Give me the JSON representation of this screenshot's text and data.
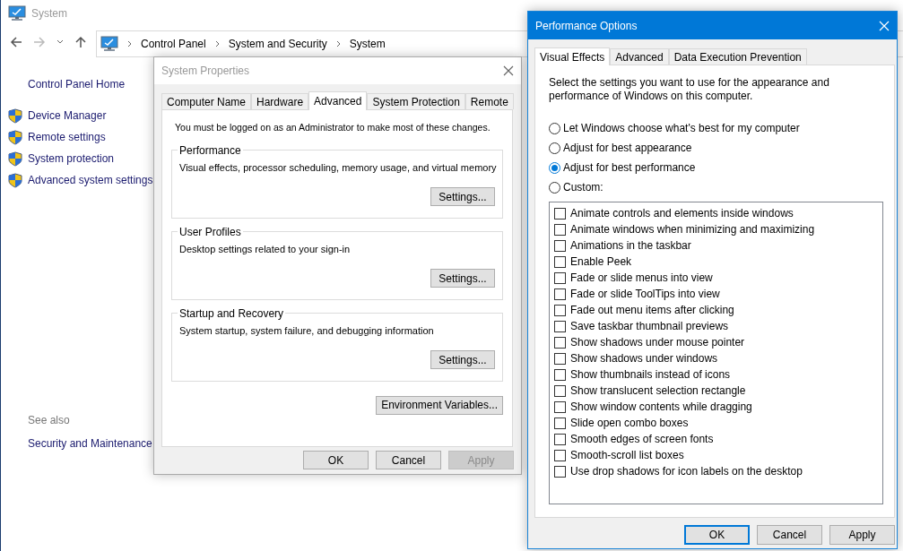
{
  "background_window": {
    "title": "System",
    "breadcrumb": [
      "Control Panel",
      "System and Security",
      "System"
    ],
    "sidebar": {
      "home": "Control Panel Home",
      "items": [
        "Device Manager",
        "Remote settings",
        "System protection",
        "Advanced system settings"
      ],
      "see_also": "See also",
      "see_also_items": [
        "Security and Maintenance"
      ]
    }
  },
  "system_properties": {
    "title": "System Properties",
    "tabs": [
      {
        "label": "Computer Name",
        "selected": false
      },
      {
        "label": "Hardware",
        "selected": false
      },
      {
        "label": "Advanced",
        "selected": true
      },
      {
        "label": "System Protection",
        "selected": false
      },
      {
        "label": "Remote",
        "selected": false
      }
    ],
    "notice": "You must be logged on as an Administrator to make most of these changes.",
    "groups": [
      {
        "title": "Performance",
        "description": "Visual effects, processor scheduling, memory usage, and virtual memory",
        "button": "Settings..."
      },
      {
        "title": "User Profiles",
        "description": "Desktop settings related to your sign-in",
        "button": "Settings..."
      },
      {
        "title": "Startup and Recovery",
        "description": "System startup, system failure, and debugging information",
        "button": "Settings..."
      }
    ],
    "env_button": "Environment Variables...",
    "buttons": [
      {
        "label": "OK",
        "disabled": false
      },
      {
        "label": "Cancel",
        "disabled": false
      },
      {
        "label": "Apply",
        "disabled": true
      }
    ]
  },
  "performance_options": {
    "title": "Performance Options",
    "tabs": [
      {
        "label": "Visual Effects",
        "selected": true
      },
      {
        "label": "Advanced",
        "selected": false
      },
      {
        "label": "Data Execution Prevention",
        "selected": false
      }
    ],
    "description": "Select the settings you want to use for the appearance and performance of Windows on this computer.",
    "options": [
      {
        "label": "Let Windows choose what's best for my computer",
        "selected": false
      },
      {
        "label": "Adjust for best appearance",
        "selected": false
      },
      {
        "label": "Adjust for best performance",
        "selected": true
      },
      {
        "label": "Custom:",
        "selected": false
      }
    ],
    "effects": [
      {
        "label": "Animate controls and elements inside windows",
        "checked": false
      },
      {
        "label": "Animate windows when minimizing and maximizing",
        "checked": false
      },
      {
        "label": "Animations in the taskbar",
        "checked": false
      },
      {
        "label": "Enable Peek",
        "checked": false
      },
      {
        "label": "Fade or slide menus into view",
        "checked": false
      },
      {
        "label": "Fade or slide ToolTips into view",
        "checked": false
      },
      {
        "label": "Fade out menu items after clicking",
        "checked": false
      },
      {
        "label": "Save taskbar thumbnail previews",
        "checked": false
      },
      {
        "label": "Show shadows under mouse pointer",
        "checked": false
      },
      {
        "label": "Show shadows under windows",
        "checked": false
      },
      {
        "label": "Show thumbnails instead of icons",
        "checked": false
      },
      {
        "label": "Show translucent selection rectangle",
        "checked": false
      },
      {
        "label": "Show window contents while dragging",
        "checked": false
      },
      {
        "label": "Slide open combo boxes",
        "checked": false
      },
      {
        "label": "Smooth edges of screen fonts",
        "checked": false
      },
      {
        "label": "Smooth-scroll list boxes",
        "checked": false
      },
      {
        "label": "Use drop shadows for icon labels on the desktop",
        "checked": false
      }
    ],
    "buttons": [
      {
        "label": "OK",
        "focused": true
      },
      {
        "label": "Cancel",
        "focused": false
      },
      {
        "label": "Apply",
        "focused": false
      }
    ]
  }
}
